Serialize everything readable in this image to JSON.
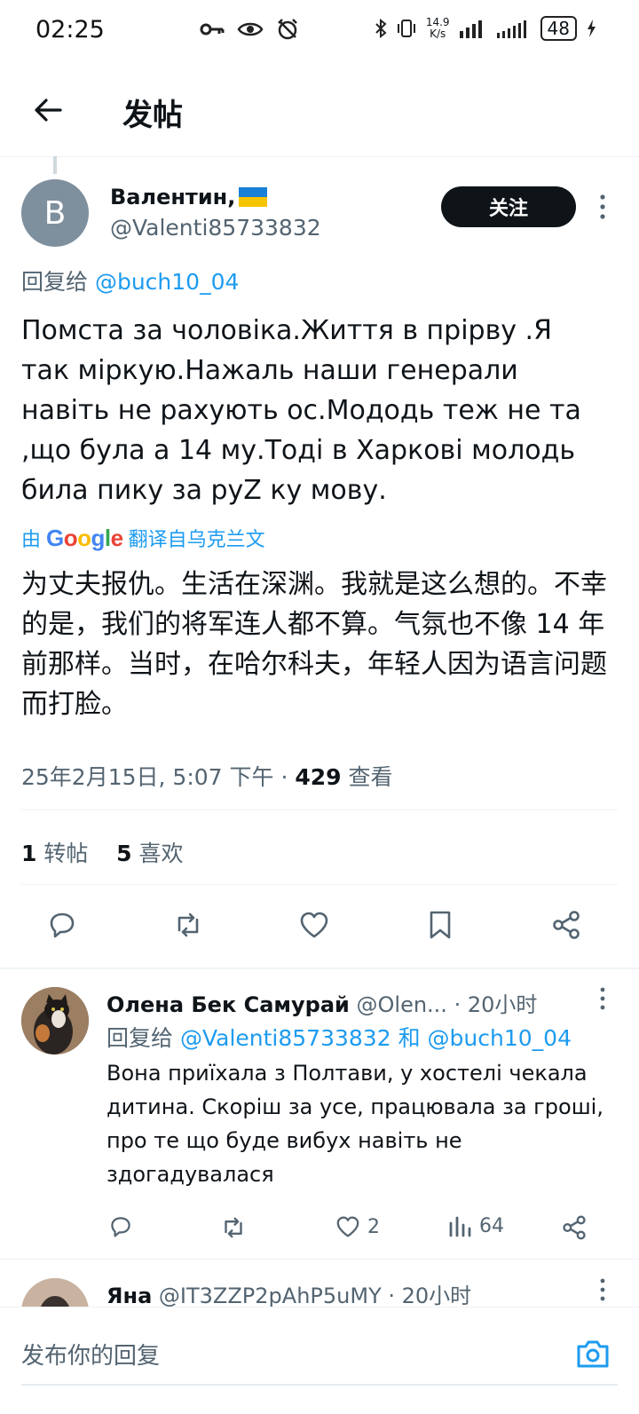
{
  "status_bar": {
    "time": "02:25",
    "net_speed_value": "14.9",
    "net_speed_unit": "K/s",
    "battery": "48"
  },
  "header": {
    "title": "发帖"
  },
  "post": {
    "avatar_letter": "B",
    "author_name": "Валентин,",
    "author_handle": "@Valenti85733832",
    "follow_label": "关注",
    "reply_to_prefix": "回复给",
    "reply_to_handle": "@buch10_04",
    "text": "Помста за чоловіка.Життя в прірву .Я так міркую.Нажаль наши генерали навіть не рахують ос.Мододь теж не та ,що була а 14 му.Тоді  в Харкові молодь била пику за руZ ку мову.",
    "translate_by": "由",
    "translate_google": "Google",
    "translate_from": "翻译自乌克兰文",
    "translated_text": "为丈夫报仇。生活在深渊。我就是这么想的。不幸的是，我们的将军连人都不算。气氛也不像 14 年前那样。当时，在哈尔科夫，年轻人因为语言问题而打脸。",
    "datetime": "25年2月15日, 5:07 下午 · ",
    "views_count": "429",
    "views_label": " 查看",
    "reposts_count": "1",
    "reposts_label": "转帖",
    "likes_count": "5",
    "likes_label": "喜欢"
  },
  "reply1": {
    "name": "Олена Бек Самурай",
    "handle": "@Olen...",
    "time": " · 20小时",
    "reply_prefix": "回复给",
    "reply_handle_1": "@Valenti85733832",
    "reply_and": "和",
    "reply_handle_2": "@buch10_04",
    "text": "Вона приїхала  з Полтави, у хостелі чекала дитина. Скоріш за усе, працювала  за гроші, про те що буде вибух навіть не здогадувалася",
    "likes": "2",
    "views": "64"
  },
  "reply2": {
    "name": "Яна",
    "handle": "@IT3ZZP2pAhP5uMY",
    "time": " · 20小时"
  },
  "composer": {
    "placeholder": "发布你的回复"
  },
  "colors": {
    "link": "#1d9bf0",
    "secondary": "#536471",
    "primary": "#0f1419"
  },
  "icons": [
    "back-arrow-icon",
    "more-vert-icon",
    "reply-icon",
    "repost-icon",
    "like-icon",
    "bookmark-icon",
    "share-icon",
    "views-icon",
    "camera-icon",
    "ukraine-flag-icon"
  ]
}
